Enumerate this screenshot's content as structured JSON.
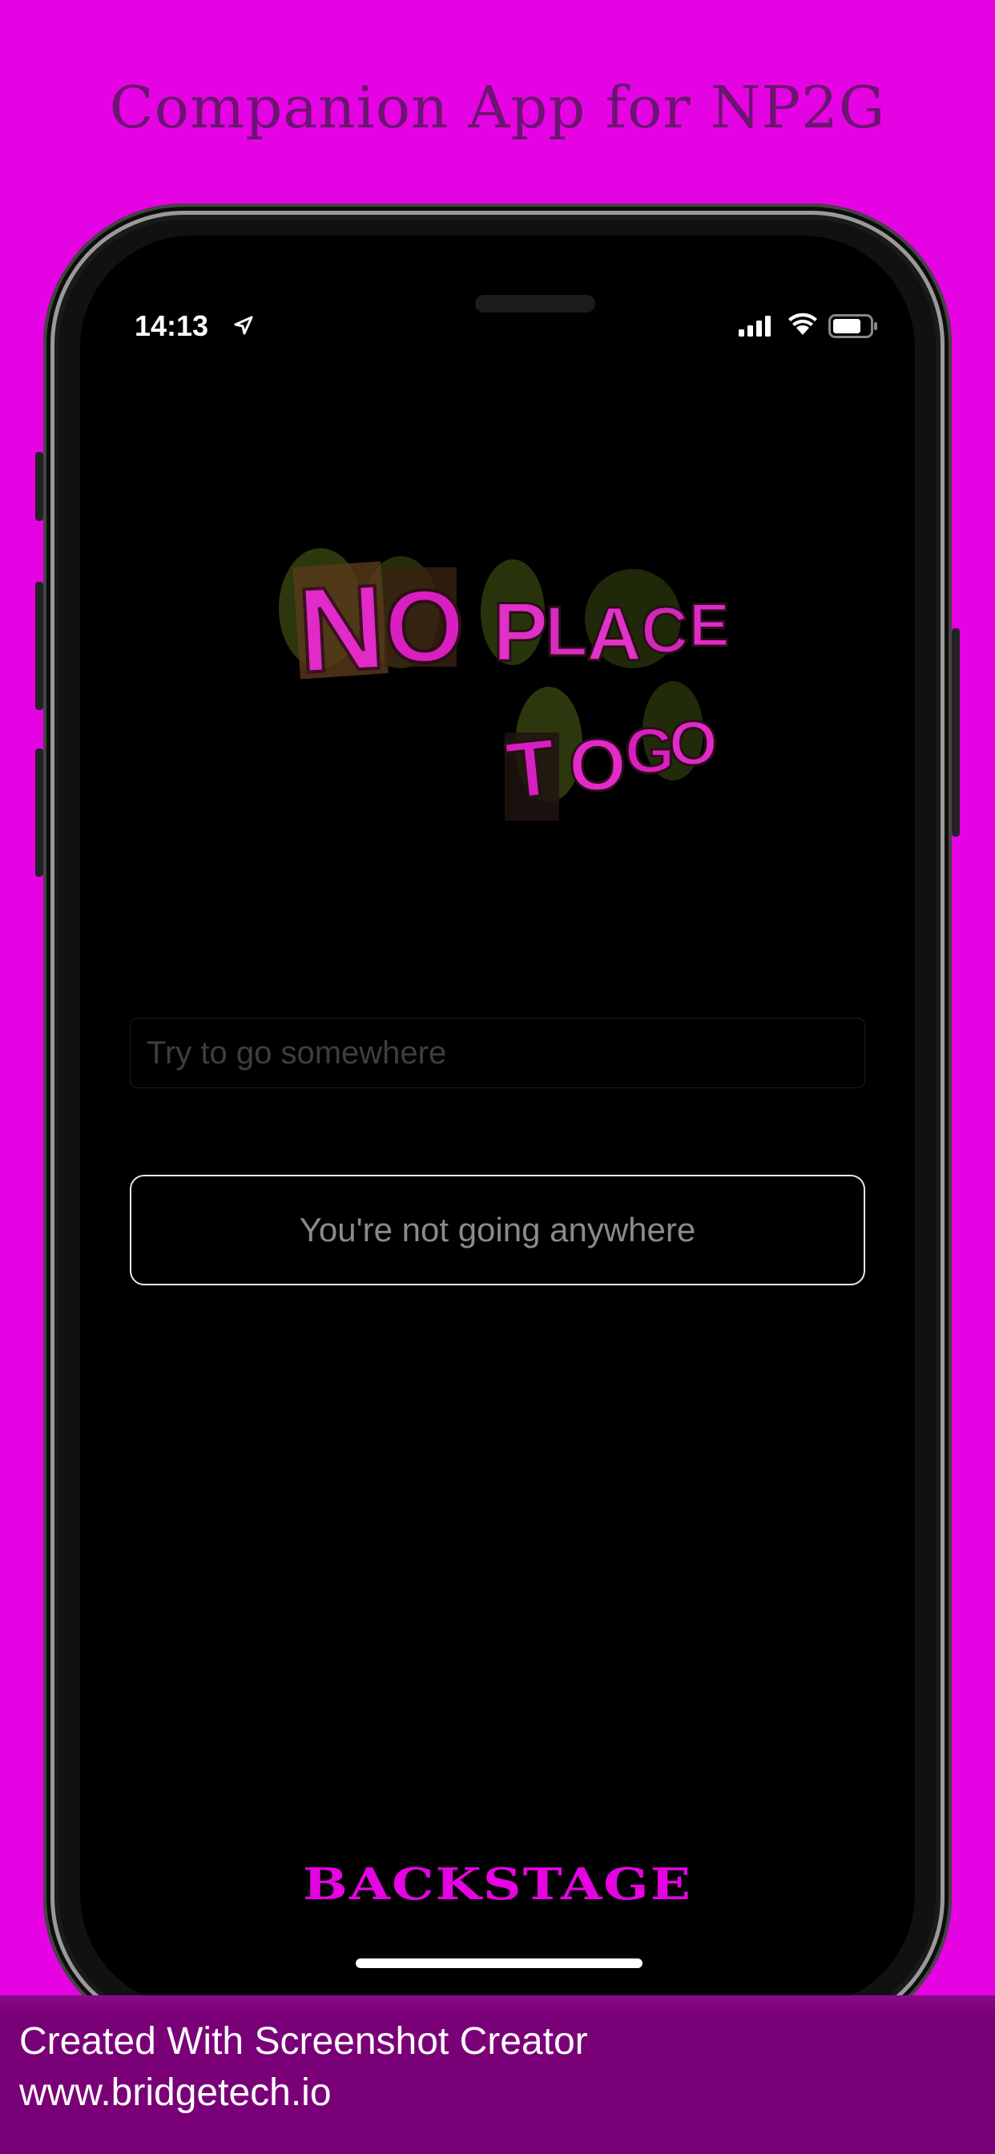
{
  "header": {
    "title": "Companion App for NP2G"
  },
  "status_bar": {
    "time": "14:13",
    "icons": [
      "location-arrow-icon",
      "cellular-signal-icon",
      "wifi-icon",
      "battery-icon"
    ]
  },
  "logo": {
    "line1": "NO PLACE",
    "line2": "TO GO"
  },
  "search": {
    "placeholder": "Try to go somewhere",
    "value": ""
  },
  "button": {
    "label": "You're not going anywhere"
  },
  "footer_brand": {
    "label": "BACKSTAGE"
  },
  "banner": {
    "line1": "Created With Screenshot Creator",
    "line2": "www.bridgetech.io"
  },
  "colors": {
    "background": "#e603e3",
    "headline": "#6b1470",
    "banner": "#7a0078",
    "screen": "#000000",
    "brand": "#e603e3"
  }
}
